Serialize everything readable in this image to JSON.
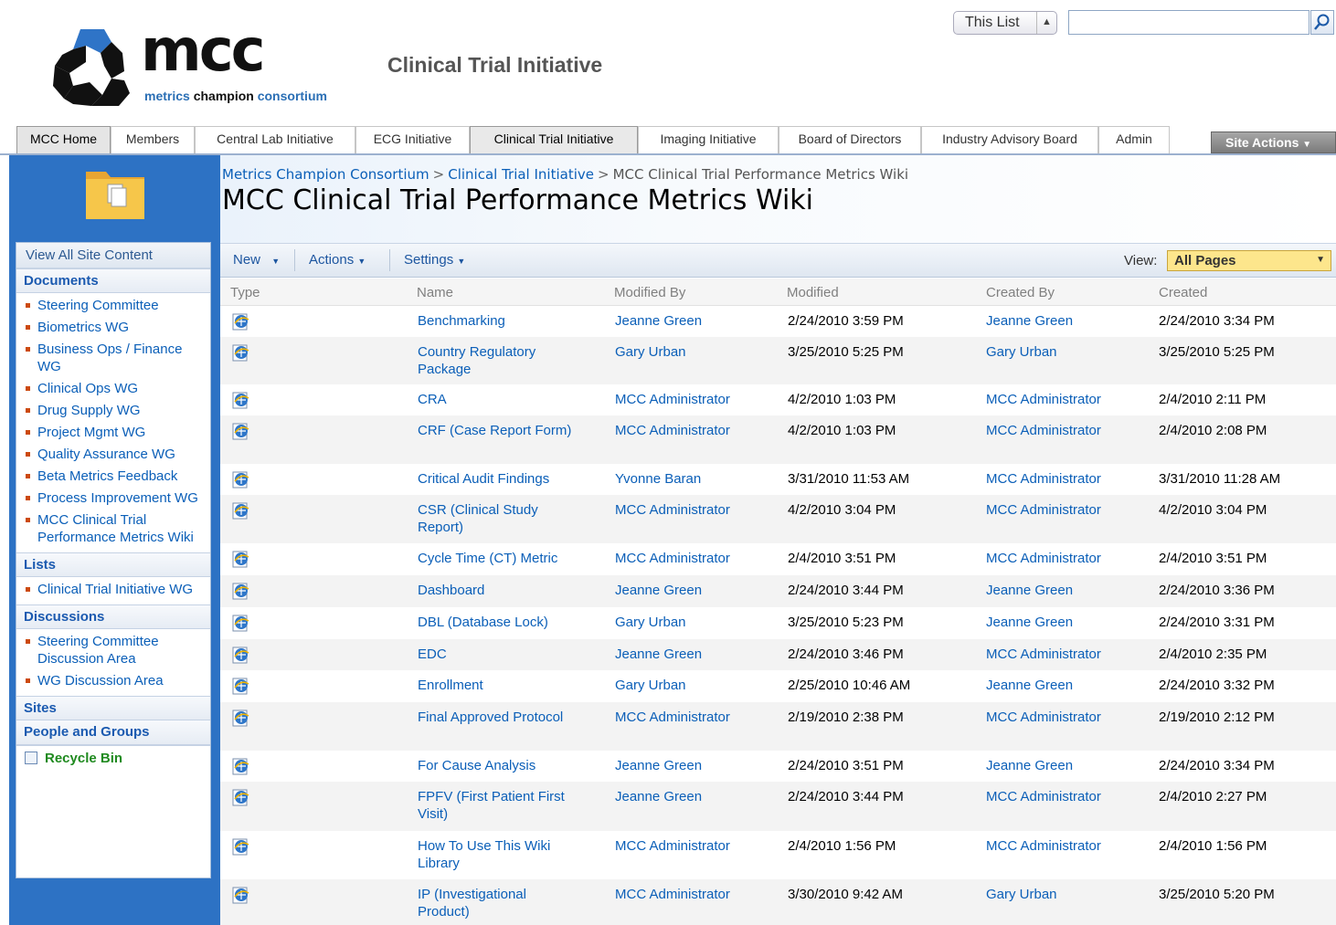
{
  "header": {
    "logo_word": "mcc",
    "logo_tagline": [
      "metrics ",
      "champion",
      " consortium"
    ],
    "site_title": "Clinical Trial Initiative",
    "search_scope": "This List",
    "search_placeholder": ""
  },
  "tabs": [
    {
      "label": "MCC Home"
    },
    {
      "label": "Members"
    },
    {
      "label": "Central Lab Initiative"
    },
    {
      "label": "ECG Initiative"
    },
    {
      "label": "Clinical Trial Initiative",
      "selected": true
    },
    {
      "label": "Imaging Initiative"
    },
    {
      "label": "Board of Directors"
    },
    {
      "label": "Industry Advisory Board"
    },
    {
      "label": "Admin"
    }
  ],
  "site_actions_label": "Site Actions",
  "breadcrumb": {
    "items": [
      "Metrics Champion Consortium",
      "Clinical Trial Initiative",
      "MCC Clinical Trial Performance Metrics Wiki"
    ],
    "separator": ">"
  },
  "page_title": "MCC Clinical Trial Performance Metrics Wiki",
  "quicklaunch": {
    "view_all": "View All Site Content",
    "documents_heading": "Documents",
    "documents": [
      "Steering Committee",
      "Biometrics WG",
      "Business Ops / Finance WG",
      "Clinical Ops WG",
      "Drug Supply WG",
      "Project Mgmt WG",
      "Quality Assurance WG",
      "Beta Metrics Feedback",
      "Process Improvement WG",
      "MCC Clinical Trial Performance Metrics Wiki"
    ],
    "lists_heading": "Lists",
    "lists": [
      "Clinical Trial Initiative WG"
    ],
    "discussions_heading": "Discussions",
    "discussions": [
      "Steering Committee Discussion Area",
      "WG Discussion Area"
    ],
    "sites_heading": "Sites",
    "people_heading": "People and Groups",
    "recycle_bin": "Recycle Bin"
  },
  "toolbar": {
    "new_label": "New",
    "actions_label": "Actions",
    "settings_label": "Settings",
    "view_label": "View:",
    "view_value": "All Pages"
  },
  "columns": [
    "Type",
    "Name",
    "Modified By",
    "Modified",
    "Created By",
    "Created"
  ],
  "rows": [
    {
      "name": "Benchmarking",
      "modified_by": "Jeanne Green",
      "modified": "2/24/2010 3:59 PM",
      "created_by": "Jeanne Green",
      "created": "2/24/2010 3:34 PM"
    },
    {
      "name": "Country Regulatory Package",
      "modified_by": "Gary Urban",
      "modified": "3/25/2010 5:25 PM",
      "created_by": "Gary Urban",
      "created": "3/25/2010 5:25 PM"
    },
    {
      "name": "CRA",
      "modified_by": "MCC Administrator",
      "modified": "4/2/2010 1:03 PM",
      "created_by": "MCC Administrator",
      "created": "2/4/2010 2:11 PM"
    },
    {
      "name": "CRF (Case Report Form)",
      "modified_by": "MCC Administrator",
      "modified": "4/2/2010 1:03 PM",
      "created_by": "MCC Administrator",
      "created": "2/4/2010 2:08 PM"
    },
    {
      "name": "Critical Audit Findings",
      "modified_by": "Yvonne Baran",
      "modified": "3/31/2010 11:53 AM",
      "created_by": "MCC Administrator",
      "created": "3/31/2010 11:28 AM"
    },
    {
      "name": "CSR (Clinical Study Report)",
      "modified_by": "MCC Administrator",
      "modified": "4/2/2010 3:04 PM",
      "created_by": "MCC Administrator",
      "created": "4/2/2010 3:04 PM"
    },
    {
      "name": "Cycle Time (CT) Metric",
      "modified_by": "MCC Administrator",
      "modified": "2/4/2010 3:51 PM",
      "created_by": "MCC Administrator",
      "created": "2/4/2010 3:51 PM"
    },
    {
      "name": "Dashboard",
      "modified_by": "Jeanne Green",
      "modified": "2/24/2010 3:44 PM",
      "created_by": "Jeanne Green",
      "created": "2/24/2010 3:36 PM"
    },
    {
      "name": "DBL (Database Lock)",
      "modified_by": "Gary Urban",
      "modified": "3/25/2010 5:23 PM",
      "created_by": "Jeanne Green",
      "created": "2/24/2010 3:31 PM"
    },
    {
      "name": "EDC",
      "modified_by": "Jeanne Green",
      "modified": "2/24/2010 3:46 PM",
      "created_by": "MCC Administrator",
      "created": "2/4/2010 2:35 PM"
    },
    {
      "name": "Enrollment",
      "modified_by": "Gary Urban",
      "modified": "2/25/2010 10:46 AM",
      "created_by": "Jeanne Green",
      "created": "2/24/2010 3:32 PM"
    },
    {
      "name": "Final Approved Protocol",
      "modified_by": "MCC Administrator",
      "modified": "2/19/2010 2:38 PM",
      "created_by": "MCC Administrator",
      "created": "2/19/2010 2:12 PM"
    },
    {
      "name": "For Cause Analysis",
      "modified_by": "Jeanne Green",
      "modified": "2/24/2010 3:51 PM",
      "created_by": "Jeanne Green",
      "created": "2/24/2010 3:34 PM"
    },
    {
      "name": "FPFV (First Patient First Visit)",
      "modified_by": "Jeanne Green",
      "modified": "2/24/2010 3:44 PM",
      "created_by": "MCC Administrator",
      "created": "2/4/2010 2:27 PM"
    },
    {
      "name": "How To Use This Wiki Library",
      "modified_by": "MCC Administrator",
      "modified": "2/4/2010 1:56 PM",
      "created_by": "MCC Administrator",
      "created": "2/4/2010 1:56 PM"
    },
    {
      "name": "IP (Investigational Product)",
      "modified_by": "MCC Administrator",
      "modified": "3/30/2010 9:42 AM",
      "created_by": "Gary Urban",
      "created": "3/25/2010 5:20 PM"
    }
  ]
}
